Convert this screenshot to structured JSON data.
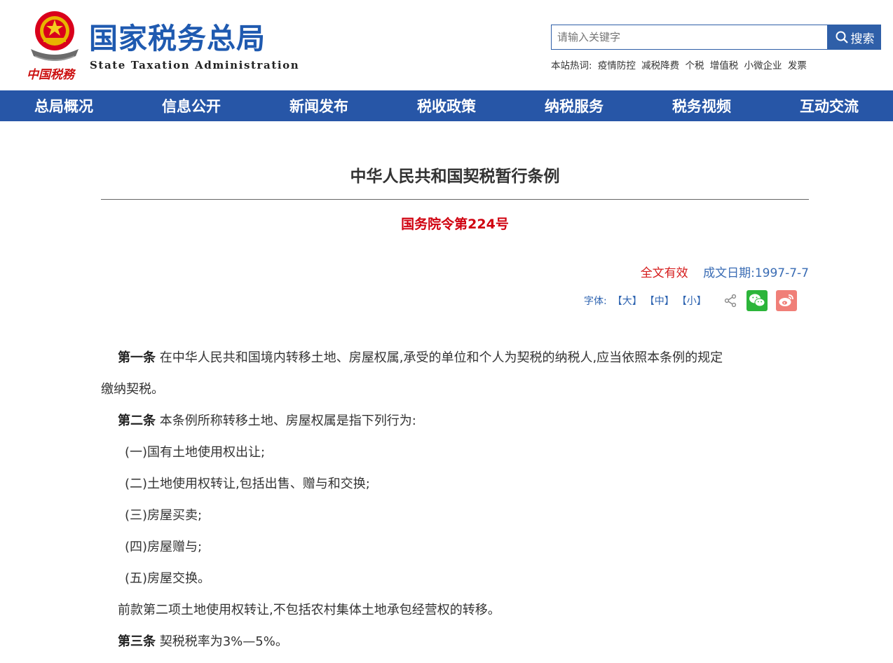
{
  "header": {
    "logo_cn": "国家税务总局",
    "logo_en": "State Taxation Administration",
    "search_placeholder": "请输入关键字",
    "search_button": "搜索",
    "hot_label": "本站热词:",
    "hot_words": [
      "疫情防控",
      "减税降费",
      "个税",
      "增值税",
      "小微企业",
      "发票"
    ]
  },
  "nav": [
    "总局概况",
    "信息公开",
    "新闻发布",
    "税收政策",
    "纳税服务",
    "税务视频",
    "互动交流"
  ],
  "article": {
    "title": "中华人民共和国契税暂行条例",
    "order": "国务院令第224号",
    "validity": "全文有效",
    "date": "成文日期:1997-7-7",
    "font_label": "字体:",
    "font_large": "【大】",
    "font_medium": "【中】",
    "font_small": "【小】"
  },
  "content": {
    "a1_head": "第一条",
    "a1_text": " 在中华人民共和国境内转移土地、房屋权属,承受的单位和个人为契税的纳税人,应当依照本条例的规定",
    "a1_cont": "缴纳契税。",
    "a2_head": "第二条",
    "a2_text": " 本条例所称转移土地、房屋权属是指下列行为:",
    "items": [
      "(一)国有土地使用权出让;",
      "(二)土地使用权转让,包括出售、赠与和交换;",
      "(三)房屋买卖;",
      "(四)房屋赠与;",
      "(五)房屋交换。"
    ],
    "note": "前款第二项土地使用权转让,不包括农村集体土地承包经营权的转移。",
    "a3_head": "第三条",
    "a3_text": " 契税税率为3%—5%。"
  },
  "colors": {
    "nav_bg": "#2756a7",
    "logo_blue": "#1f5ab0",
    "order_red": "#d0000f",
    "date_blue": "#3a6cb4"
  }
}
